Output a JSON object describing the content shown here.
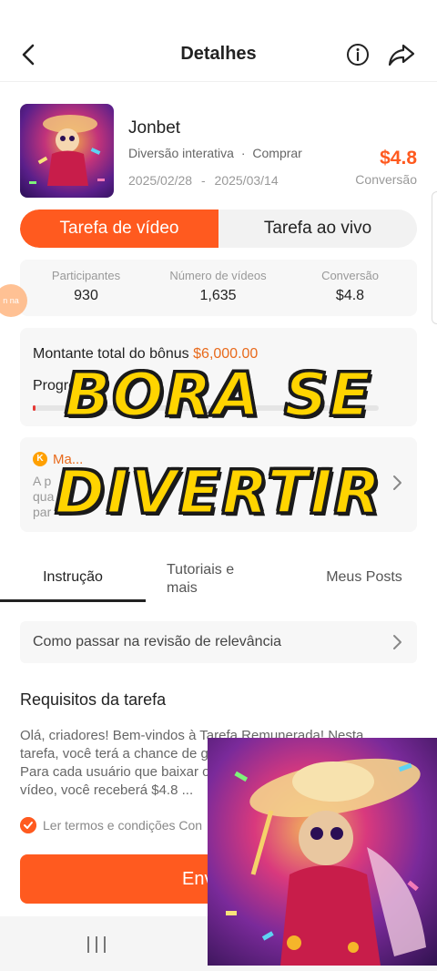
{
  "header": {
    "title": "Detalhes"
  },
  "app": {
    "name": "Jonbet",
    "category": "Diversão interativa",
    "separator": "·",
    "action": "Comprar",
    "start_date": "2025/02/28",
    "date_separator": "-",
    "end_date": "2025/03/14",
    "price": "$4.8",
    "price_label": "Conversão"
  },
  "task_tabs": {
    "video": "Tarefa de vídeo",
    "live": "Tarefa ao vivo",
    "active": "video"
  },
  "stats": [
    {
      "label": "Participantes",
      "value": "930"
    },
    {
      "label": "Número de vídeos",
      "value": "1,635"
    },
    {
      "label": "Conversão",
      "value": "$4.8"
    }
  ],
  "side_badge": "n na",
  "bonus": {
    "label": "Montante total do bônus",
    "amount": "$6,000.00",
    "progress_label": "Progre",
    "progress_fraction": 0.008
  },
  "notice": {
    "coin": "K",
    "title": "Ma...",
    "body_line1": "A p",
    "body_line2": "qua",
    "body_line3": "par"
  },
  "overlay": {
    "line1": "BORA SE",
    "line2": "DIVERTIR"
  },
  "content_tabs": {
    "instructions": "Instrução",
    "tutorials_line1": "Tutoriais e",
    "tutorials_line2": "mais",
    "my_posts": "Meus Posts"
  },
  "relevance_link": "Como passar na revisão de relevância",
  "requirements": {
    "title": "Requisitos da tarefa",
    "body": "Olá, criadores! Bem-vindos à Tarefa Remunerada! Nesta tarefa, você terá a chance de ganhar até $6,000.00. Para cada usuário que baixar o app através do seu vídeo, você receberá $4.8 ..."
  },
  "terms": {
    "text": "Ler termos e condições Con"
  },
  "submit": {
    "label": "Envia"
  },
  "colors": {
    "accent": "#ff5a1f",
    "overlay_text": "#ffd400"
  },
  "icons": [
    "back-arrow-icon",
    "info-icon",
    "share-icon",
    "coin-icon",
    "chevron-right-icon",
    "check-icon",
    "recents-icon"
  ]
}
